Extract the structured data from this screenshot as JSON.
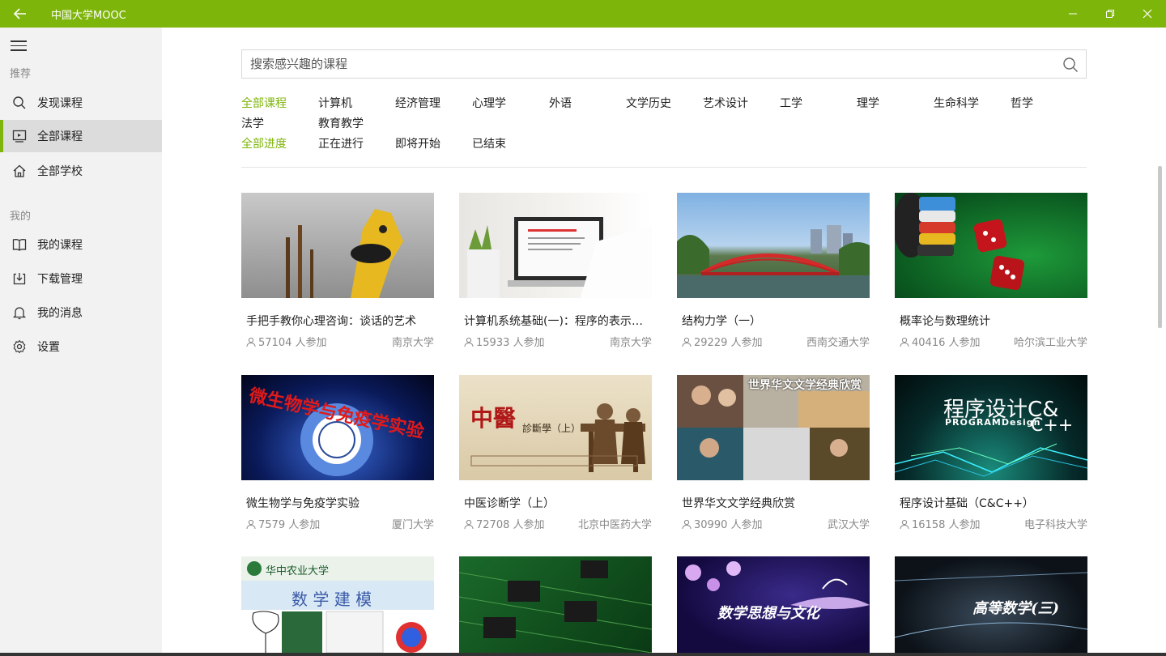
{
  "window": {
    "title": "中国大学MOOC",
    "accent": "#7eb50b"
  },
  "sidebar": {
    "sections": {
      "recommend": "推荐",
      "mine": "我的"
    },
    "items": [
      {
        "label": "发现课程",
        "icon": "search-icon",
        "active": false
      },
      {
        "label": "全部课程",
        "icon": "course-icon",
        "active": true
      },
      {
        "label": "全部学校",
        "icon": "home-icon",
        "active": false
      },
      {
        "label": "我的课程",
        "icon": "book-icon",
        "active": false
      },
      {
        "label": "下载管理",
        "icon": "download-icon",
        "active": false
      },
      {
        "label": "我的消息",
        "icon": "bell-icon",
        "active": false
      },
      {
        "label": "设置",
        "icon": "gear-icon",
        "active": false
      }
    ]
  },
  "search": {
    "placeholder": "搜索感兴趣的课程"
  },
  "filters": {
    "categories": [
      "全部课程",
      "计算机",
      "经济管理",
      "心理学",
      "外语",
      "文学历史",
      "艺术设计",
      "工学",
      "理学",
      "生命科学",
      "哲学",
      "法学",
      "教育教学"
    ],
    "progress": [
      "全部进度",
      "正在进行",
      "即将开始",
      "已结束"
    ]
  },
  "courses": [
    {
      "title": "手把手教你心理咨询：谈话的艺术",
      "count": "57104 人参加",
      "school": "南京大学"
    },
    {
      "title": "计算机系统基础(一)：程序的表示、转换与链接",
      "count": "15933 人参加",
      "school": "南京大学"
    },
    {
      "title": "结构力学（一）",
      "count": "29229 人参加",
      "school": "西南交通大学"
    },
    {
      "title": "概率论与数理统计",
      "count": "40416 人参加",
      "school": "哈尔滨工业大学"
    },
    {
      "title": "微生物学与免疫学实验",
      "count": "7579 人参加",
      "school": "厦门大学"
    },
    {
      "title": "中医诊断学（上）",
      "count": "72708 人参加",
      "school": "北京中医药大学"
    },
    {
      "title": "世界华文文学经典欣赏",
      "count": "30990 人参加",
      "school": "武汉大学"
    },
    {
      "title": "程序设计基础（C&C++）",
      "count": "16158 人参加",
      "school": "电子科技大学"
    }
  ],
  "thumb_text": {
    "micro": "微生物学与免疫学实验",
    "tcm": "中醫",
    "tcm_sub": "診斷學（上）",
    "lit": "世界华文文学经典欣赏",
    "prog": "程序设计C&",
    "prog_sub": "PROGRAMDesign",
    "prog_cpp": "C++",
    "ag_school": "华中农业大学",
    "math_model": "数 学 建 模",
    "math_thought": "数学思想与文化",
    "adv_math": "高等数学(三)"
  }
}
